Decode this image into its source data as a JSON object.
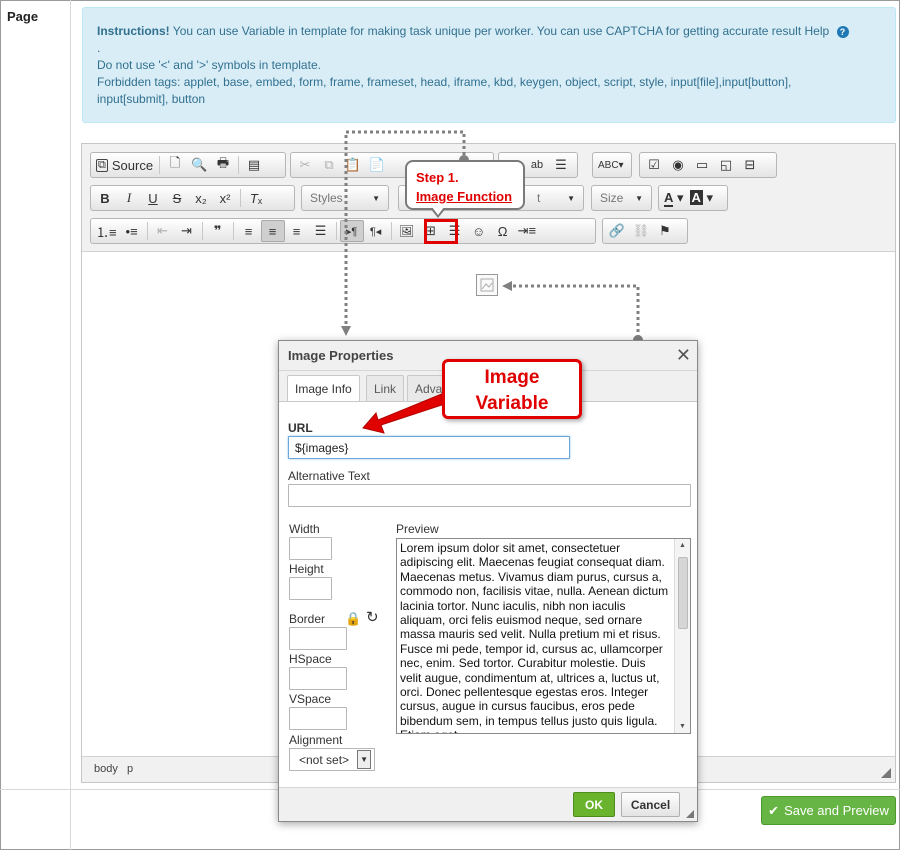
{
  "page": {
    "label": "Page"
  },
  "instructions": {
    "title": "Instructions!",
    "line1": "You can use Variable in template for making task unique per worker. You can use CAPTCHA for getting accurate result Help",
    "help_icon": "question-circle-icon",
    "dot": ".",
    "line2": "Do not use '<' and '>' symbols in template.",
    "line3": "Forbidden tags: applet, base, embed, form, frame, frameset, head, iframe, kbd, keygen, object, script, style, input[file],input[button],",
    "line4": "input[submit], button"
  },
  "toolbar": {
    "source_label": "Source",
    "styles_label": "Styles",
    "format_label": "t",
    "size_label": "Size",
    "bold_label": "B",
    "italic_label": "I",
    "underline_label": "U",
    "strike_label": "S"
  },
  "callout_step": {
    "line1": "Step 1.",
    "line2": "Image Function"
  },
  "callout_variable": {
    "line1": "Image",
    "line2": "Variable"
  },
  "statusbar": {
    "path1": "body",
    "path2": "p"
  },
  "dialog": {
    "title": "Image Properties",
    "close": "✕",
    "tabs": [
      "Image Info",
      "Link",
      "Adva"
    ],
    "url_label": "URL",
    "url_value": "${images}",
    "alt_label": "Alternative Text",
    "alt_value": "",
    "width_label": "Width",
    "height_label": "Height",
    "border_label": "Border",
    "hspace_label": "HSpace",
    "vspace_label": "VSpace",
    "alignment_label": "Alignment",
    "alignment_value": "<not set>",
    "preview_label": "Preview",
    "preview_text": "Lorem ipsum dolor sit amet, consectetuer adipiscing elit. Maecenas feugiat consequat diam. Maecenas metus. Vivamus diam purus, cursus a, commodo non, facilisis vitae, nulla. Aenean dictum lacinia tortor. Nunc iaculis, nibh non iaculis aliquam, orci felis euismod neque, sed ornare massa mauris sed velit. Nulla pretium mi et risus. Fusce mi pede, tempor id, cursus ac, ullamcorper nec, enim. Sed tortor. Curabitur molestie. Duis velit augue, condimentum at, ultrices a, luctus ut, orci. Donec pellentesque egestas eros. Integer cursus, augue in cursus faucibus, eros pede bibendum sem, in tempus tellus justo quis ligula. Etiam eget",
    "ok_label": "OK",
    "cancel_label": "Cancel"
  },
  "save_button": {
    "label": "Save and Preview"
  },
  "colors": {
    "info_bg": "#d9edf7",
    "info_text": "#31708f",
    "annotation_red": "#e00000",
    "ok_green": "#69b32d",
    "save_green": "#66b545"
  }
}
